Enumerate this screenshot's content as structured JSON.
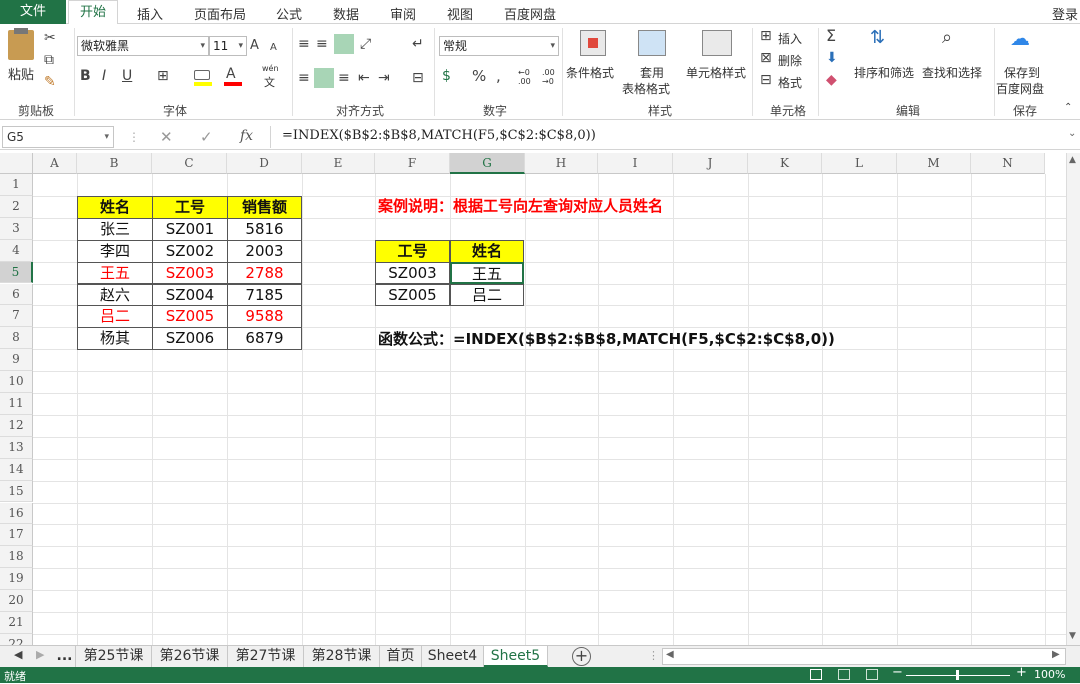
{
  "menubar": {
    "file": "文件",
    "tabs": [
      "开始",
      "插入",
      "页面布局",
      "公式",
      "数据",
      "审阅",
      "视图",
      "百度网盘"
    ],
    "login": "登录"
  },
  "ribbon": {
    "clipboard": {
      "paste": "粘贴",
      "label": "剪贴板"
    },
    "font": {
      "name": "微软雅黑",
      "size": "11",
      "label": "字体",
      "bold": "B",
      "italic": "I",
      "underline": "U",
      "grow": "A",
      "shrink": "A",
      "color_a": "A",
      "wen": "wén",
      "wen_char": "文"
    },
    "alignment": {
      "label": "对齐方式"
    },
    "number": {
      "format": "常规",
      "label": "数字",
      "percent": "%",
      "comma": ",",
      "inc": "←0 .00",
      "dec": ".00 →0"
    },
    "styles": {
      "cond": "条件格式",
      "table_1": "套用",
      "table_2": "表格格式",
      "cell": "单元格样式",
      "label": "样式"
    },
    "cells": {
      "insert": "插入",
      "delete": "删除",
      "format": "格式",
      "label": "单元格"
    },
    "editing": {
      "sort": "排序和筛选",
      "find": "查找和选择",
      "label": "编辑"
    },
    "save": {
      "line1": "保存到",
      "line2": "百度网盘",
      "label": "保存"
    }
  },
  "formula_bar": {
    "name_box": "G5",
    "formula": "=INDEX($B$2:$B$8,MATCH(F5,$C$2:$C$8,0))"
  },
  "columns": [
    "A",
    "B",
    "C",
    "D",
    "E",
    "F",
    "G",
    "H",
    "I",
    "J",
    "K",
    "L",
    "M",
    "N"
  ],
  "rows": [
    "1",
    "2",
    "3",
    "4",
    "5",
    "6",
    "7",
    "8",
    "9",
    "10",
    "11",
    "12",
    "13",
    "14",
    "15",
    "16",
    "17",
    "18",
    "19",
    "20",
    "21",
    "22"
  ],
  "table1": {
    "headers": [
      "姓名",
      "工号",
      "销售额"
    ],
    "rows": [
      [
        "张三",
        "SZ001",
        "5816"
      ],
      [
        "李四",
        "SZ002",
        "2003"
      ],
      [
        "王五",
        "SZ003",
        "2788"
      ],
      [
        "赵六",
        "SZ004",
        "7185"
      ],
      [
        "吕二",
        "SZ005",
        "9588"
      ],
      [
        "杨其",
        "SZ006",
        "6879"
      ]
    ]
  },
  "table2": {
    "headers": [
      "工号",
      "姓名"
    ],
    "rows": [
      [
        "SZ003",
        "王五"
      ],
      [
        "SZ005",
        "吕二"
      ]
    ]
  },
  "case_note": "案例说明：根据工号向左查询对应人员姓名",
  "formula_note": "函数公式：=INDEX($B$2:$B$8,MATCH(F5,$C$2:$C$8,0))",
  "sheet_tabs": [
    "...",
    "第25节课",
    "第26节课",
    "第27节课",
    "第28节课",
    "首页",
    "Sheet4",
    "Sheet5"
  ],
  "active_sheet": "Sheet5",
  "status": {
    "left": "就绪",
    "zoom": "100%"
  },
  "colors": {
    "accent": "#217346",
    "header_fill": "#ffff00",
    "highlight_text": "#ff0000"
  }
}
